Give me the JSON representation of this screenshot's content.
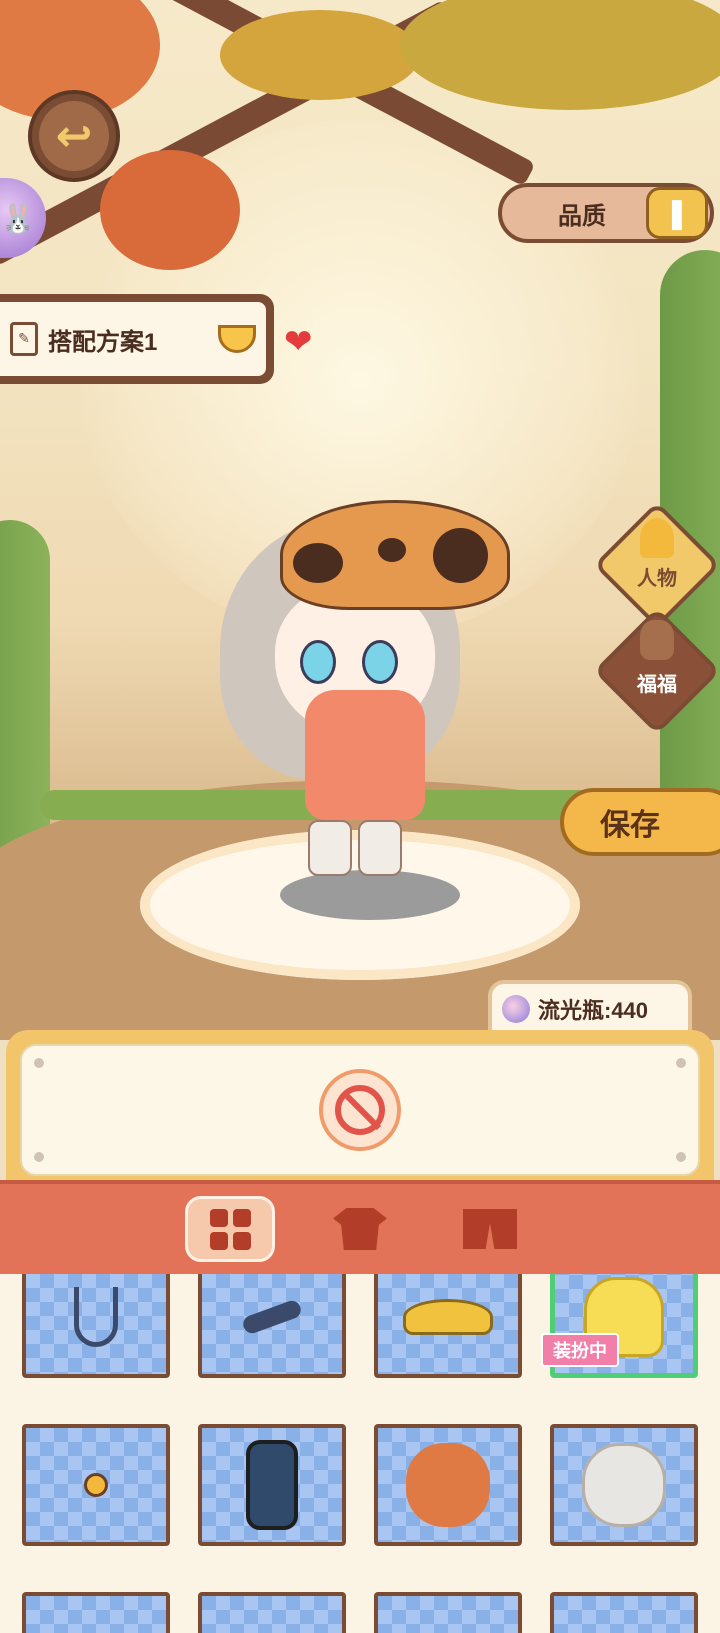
{
  "top_left": {
    "back_icon": "back-arrow-icon",
    "avatar_icon": "bunny-icon"
  },
  "quality": {
    "label": "品质",
    "toggle_icon": "toggle-icon"
  },
  "outfit": {
    "name": "搭配方案1",
    "favorite_icon": "heart-icon"
  },
  "side_buttons": [
    {
      "label": "人物",
      "icon": "person-icon"
    },
    {
      "label": "福福",
      "icon": "bunny-ears-icon"
    }
  ],
  "save": {
    "label": "保存"
  },
  "currency": {
    "text": "流光瓶:440"
  },
  "tabs": [
    {
      "name": "all",
      "icon": "grid-icon",
      "active": true
    },
    {
      "name": "tops",
      "icon": "shirt-icon",
      "active": false
    },
    {
      "name": "bottoms",
      "icon": "pants-icon",
      "active": false
    }
  ],
  "items": [
    {
      "icon": "necklace-icon",
      "equipped": false
    },
    {
      "icon": "bracelet-icon",
      "equipped": false
    },
    {
      "icon": "visor-icon",
      "equipped": false
    },
    {
      "icon": "yellow-dress-icon",
      "equipped": true,
      "badge": "装扮中"
    },
    {
      "icon": "earring-icon",
      "equipped": false
    },
    {
      "icon": "bag-icon",
      "equipped": false
    },
    {
      "icon": "orange-hair-icon",
      "equipped": false
    },
    {
      "icon": "white-hair-icon",
      "equipped": false
    }
  ],
  "colors": {
    "accent": "#e37358",
    "gold": "#f4b74a",
    "wood": "#7b4c34",
    "equipped_border": "#4fce76"
  }
}
